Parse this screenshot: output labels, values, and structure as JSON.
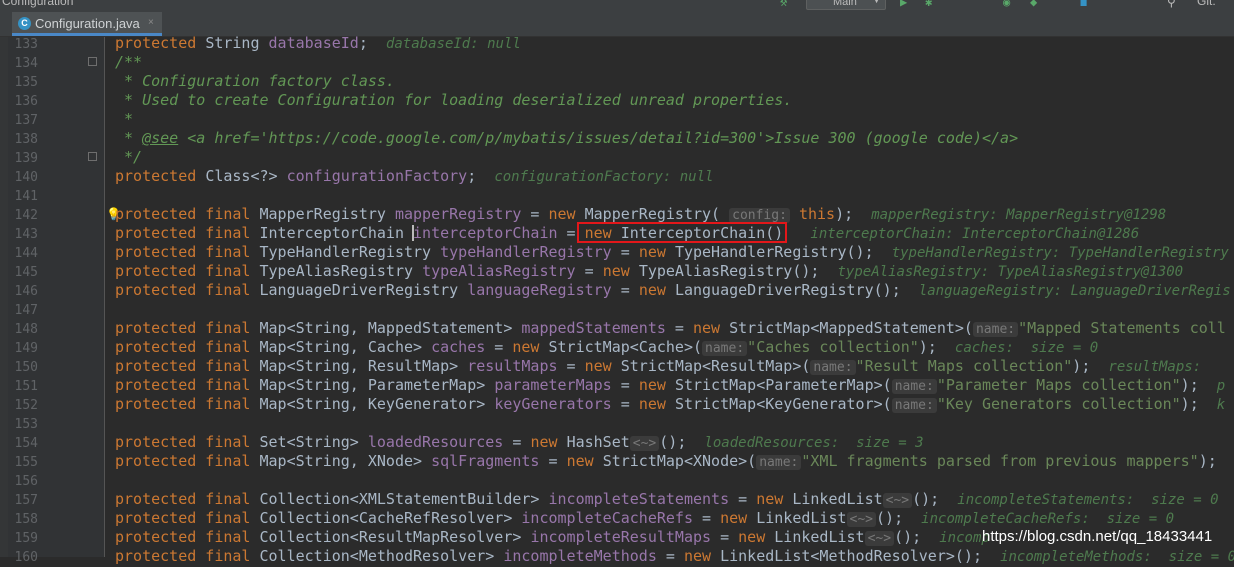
{
  "window": {
    "title": "Configuration"
  },
  "toolbar": {
    "run_config": "Main",
    "git_label": "Git:",
    "icons": [
      "hammer-icon",
      "run-icon",
      "debug-icon",
      "coverage-icon",
      "profile-icon",
      "stop-icon",
      "search-icon"
    ]
  },
  "tab": {
    "title": "Configuration.java",
    "icon": "class-icon",
    "close": "×"
  },
  "gutter": {
    "line_numbers": [
      "133",
      "134",
      "135",
      "136",
      "137",
      "138",
      "139",
      "140",
      "141",
      "142",
      "143",
      "144",
      "145",
      "146",
      "147",
      "148",
      "149",
      "150",
      "151",
      "152",
      "153",
      "154",
      "155",
      "156",
      "157",
      "158",
      "159",
      "160"
    ]
  },
  "code": {
    "l133": "protected String databaseId;  databaseId: null",
    "l134": "/**",
    "l135": " * Configuration factory class.",
    "l136": " * Used to create Configuration for loading deserialized unread properties.",
    "l137": " *",
    "l138_see": "@see",
    "l138_open": "<a href=",
    "l138_url": "'https://code.google.com/p/mybatis/issues/detail?id=300'",
    "l138_gt": ">",
    "l138_text": "Issue 300 (google code)",
    "l138_close": "</a>",
    "l139": " */",
    "l140_mod": "protected ",
    "l140_type": "Class<?> ",
    "l140_field": "configurationFactory",
    "l140_val": "configurationFactory: null",
    "l142_type": "MapperRegistry ",
    "l142_field": "mapperRegistry",
    "l142_ctor": "MapperRegistry(",
    "l142_hint": "config:",
    "l142_this": "this",
    "l142_val": "mapperRegistry: MapperRegistry@1298",
    "l143_type": "InterceptorChain ",
    "l143_field": "interceptorChain",
    "l143_ctor": "InterceptorChain()",
    "l143_val": "interceptorChain: InterceptorChain@1286",
    "l144_type": "TypeHandlerRegistry ",
    "l144_field": "typeHandlerRegistry",
    "l144_ctor": "TypeHandlerRegistry()",
    "l144_val": "typeHandlerRegistry: TypeHandlerRegistry",
    "l145_type": "TypeAliasRegistry ",
    "l145_field": "typeAliasRegistry",
    "l145_ctor": "TypeAliasRegistry()",
    "l145_val": "typeAliasRegistry: TypeAliasRegistry@1300",
    "l146_type": "LanguageDriverRegistry ",
    "l146_field": "languageRegistry",
    "l146_ctor": "LanguageDriverRegistry()",
    "l146_val": "languageRegistry: LanguageDriverRegis",
    "l148_type": "Map<String, MappedStatement> ",
    "l148_field": "mappedStatements",
    "l148_ctor": "StrictMap<MappedStatement>(",
    "l148_hint": "name:",
    "l148_str": "\"Mapped Statements coll",
    "l149_type": "Map<String, Cache> ",
    "l149_field": "caches",
    "l149_ctor": "StrictMap<Cache>(",
    "l149_hint": "name:",
    "l149_str": "\"Caches collection\"",
    "l149_val": "caches:  size = 0",
    "l150_type": "Map<String, ResultMap> ",
    "l150_field": "resultMaps",
    "l150_ctor": "StrictMap<ResultMap>(",
    "l150_hint": "name:",
    "l150_str": "\"Result Maps collection\"",
    "l150_val": "resultMaps:",
    "l151_type": "Map<String, ParameterMap> ",
    "l151_field": "parameterMaps",
    "l151_ctor": "StrictMap<ParameterMap>(",
    "l151_hint": "name:",
    "l151_str": "\"Parameter Maps collection\"",
    "l151_val": "p",
    "l152_type": "Map<String, KeyGenerator> ",
    "l152_field": "keyGenerators",
    "l152_ctor": "StrictMap<KeyGenerator>(",
    "l152_hint": "name:",
    "l152_str": "\"Key Generators collection\"",
    "l152_val": "k",
    "l154_type": "Set<String> ",
    "l154_field": "loadedResources",
    "l154_ctor": "HashSet",
    "l154_diamond": "<~>",
    "l154_val": "loadedResources:  size = 3",
    "l155_type": "Map<String, XNode> ",
    "l155_field": "sqlFragments",
    "l155_ctor": "StrictMap<XNode>(",
    "l155_hint": "name:",
    "l155_str": "\"XML fragments parsed from previous mappers\"",
    "l157_type": "Collection<XMLStatementBuilder> ",
    "l157_field": "incompleteStatements",
    "l157_ctor": "LinkedList",
    "l157_diamond": "<~>",
    "l157_val": "incompleteStatements:  size = 0",
    "l158_type": "Collection<CacheRefResolver> ",
    "l158_field": "incompleteCacheRefs",
    "l158_ctor": "LinkedList",
    "l158_diamond": "<~>",
    "l158_val": "incompleteCacheRefs:  size = 0",
    "l159_type": "Collection<ResultMapResolver> ",
    "l159_field": "incompleteResultMaps",
    "l159_ctor": "LinkedList",
    "l159_diamond": "<~>",
    "l159_val": "incomp",
    "l160_type": "Collection<MethodResolver> ",
    "l160_field": "incompleteMethods",
    "l160_ctor": "LinkedList<MethodResolver>()",
    "l160_val": "incompleteMethods:  size = 0"
  },
  "kw": {
    "protected": "protected",
    "final": "final",
    "new": "new"
  },
  "watermark": "https://blog.csdn.net/qq_18433441",
  "colors": {
    "keyword": "#cc7832",
    "field": "#9876aa",
    "string": "#6a8759",
    "comment": "#629755",
    "highlight_box": "#e3171a",
    "background": "#2b2b2b"
  }
}
